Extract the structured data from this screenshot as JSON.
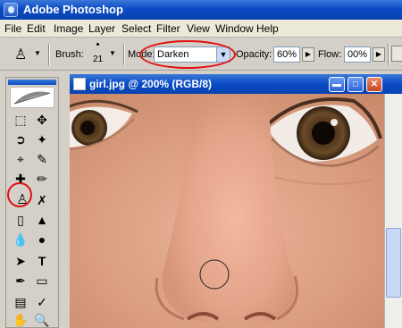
{
  "app": {
    "title": "Adobe Photoshop",
    "menu": [
      "File",
      "Edit",
      "Image",
      "Layer",
      "Select",
      "Filter",
      "View",
      "Window",
      "Help"
    ]
  },
  "options": {
    "brush_label": "Brush:",
    "brush_size": "21",
    "mode_label": "Mode:",
    "mode_value": "Darken",
    "opacity_label": "Opacity:",
    "opacity_value": "60%",
    "flow_label": "Flow:",
    "flow_value": "00%"
  },
  "document": {
    "title": "girl.jpg @ 200% (RGB/8)"
  },
  "toolbox": {
    "tools": [
      "marquee-tool",
      "move-tool",
      "lasso-tool",
      "magic-wand-tool",
      "crop-tool",
      "slice-tool",
      "healing-brush-tool",
      "brush-tool",
      "clone-stamp-tool",
      "history-brush-tool",
      "eraser-tool",
      "paint-bucket-tool",
      "blur-tool",
      "dodge-tool",
      "path-selection-tool",
      "type-tool",
      "pen-tool",
      "shape-tool",
      "notes-tool",
      "eyedropper-tool",
      "hand-tool",
      "zoom-tool"
    ],
    "highlighted_tool": "clone-stamp-tool"
  },
  "colors": {
    "title_bar": "#0a4bc4",
    "highlight_ring": "#e01010",
    "skin": "#e0a98c"
  }
}
